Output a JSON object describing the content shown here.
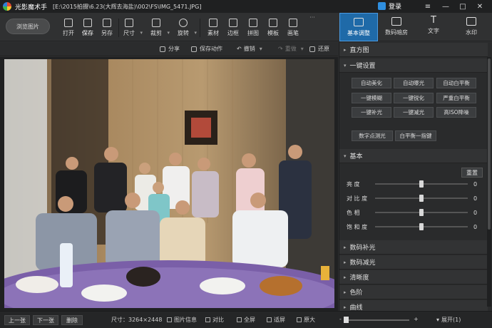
{
  "title_bar": {
    "app_title": "光影魔术手",
    "file_path": "[E:\\2015拍摄\\6.23(大辉去海盐)\\002\\FS\\IMG_5471.JPG]",
    "login_label": "登录"
  },
  "toolbar": {
    "browse_label": "浏览图片",
    "tools": [
      {
        "label": "打开"
      },
      {
        "label": "保存"
      },
      {
        "label": "另存"
      },
      {
        "label": "尺寸"
      },
      {
        "label": "裁剪"
      },
      {
        "label": "旋转"
      },
      {
        "label": "素材"
      },
      {
        "label": "边框"
      },
      {
        "label": "拼图"
      },
      {
        "label": "模板"
      },
      {
        "label": "画笔"
      }
    ],
    "more_label": "···"
  },
  "right_tabs": [
    {
      "label": "基本调整",
      "active": true
    },
    {
      "label": "数码暗房"
    },
    {
      "label": "文字"
    },
    {
      "label": "水印"
    }
  ],
  "subbar": {
    "share": "分享",
    "save_action": "保存动作",
    "undo": "撤销",
    "redo": "重做",
    "restore": "还原"
  },
  "panel": {
    "histogram": "直方图",
    "one_click": "一键设置",
    "quick_buttons": [
      [
        "自动美化",
        "自动曝光",
        "自动白平衡"
      ],
      [
        "一键模糊",
        "一键锐化",
        "严重白平衡"
      ],
      [
        "一键补光",
        "一键减光",
        "高ISO降噪"
      ]
    ],
    "extra_buttons": [
      "数字点测光",
      "白平衡一指键"
    ],
    "basic": "基本",
    "reset": "重置",
    "sliders": [
      {
        "label": "亮    度",
        "value": "0"
      },
      {
        "label": "对 比 度",
        "value": "0"
      },
      {
        "label": "色    相",
        "value": "0"
      },
      {
        "label": "饱 和 度",
        "value": "0"
      }
    ],
    "collapsed_sections": [
      "数码补光",
      "数码减光",
      "清晰度",
      "色阶",
      "曲线"
    ]
  },
  "statusbar": {
    "prev": "上一张",
    "next": "下一张",
    "delete": "删除",
    "size_label": "尺寸：3264×2448",
    "info": "图片信息",
    "compare": "对比",
    "fullscreen": "全屏",
    "fit": "适屏",
    "original": "原大",
    "expand": "展开(1)"
  }
}
